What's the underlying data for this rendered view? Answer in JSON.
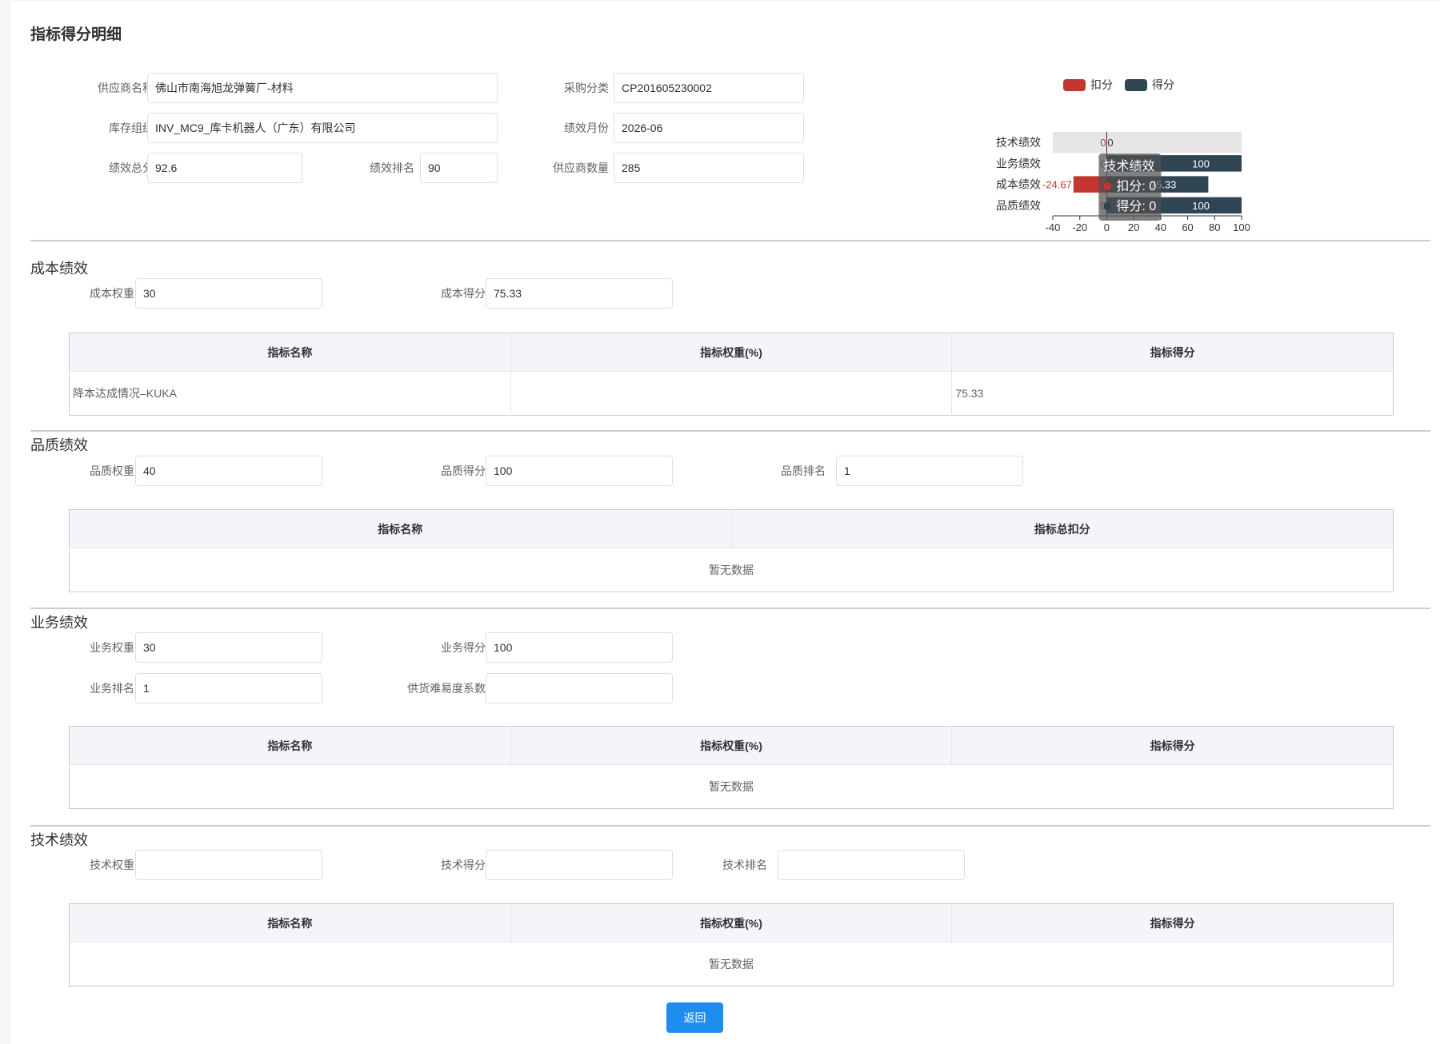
{
  "page": {
    "title": "指标得分明细"
  },
  "summary": {
    "supplier_name": {
      "label": "供应商名称",
      "value": "佛山市南海旭龙弹簧厂-材料"
    },
    "purchase_category": {
      "label": "采购分类",
      "value": "CP201605230002"
    },
    "inventory_org": {
      "label": "库存组织",
      "value": "INV_MC9_库卡机器人（广东）有限公司"
    },
    "perf_month": {
      "label": "绩效月份",
      "value": "2026-06"
    },
    "perf_total": {
      "label": "绩效总分",
      "value": "92.6"
    },
    "perf_rank": {
      "label": "绩效排名",
      "value": "90"
    },
    "supplier_count": {
      "label": "供应商数量",
      "value": "285"
    }
  },
  "chart_data": {
    "type": "bar",
    "orientation": "horizontal",
    "stacked": true,
    "categories": [
      "技术绩效",
      "业务绩效",
      "成本绩效",
      "品质绩效"
    ],
    "series": [
      {
        "name": "扣分",
        "color": "#c23531",
        "values": [
          0,
          0,
          -24.67,
          0
        ],
        "labels": [
          "0",
          "0",
          "-24.67",
          "0"
        ]
      },
      {
        "name": "得分",
        "color": "#2f4554",
        "values": [
          0,
          100,
          75.33,
          100
        ],
        "labels": [
          "0",
          "100",
          "75.33",
          "100"
        ]
      }
    ],
    "xlim": [
      -40,
      100
    ],
    "xticks": [
      "-40",
      "-20",
      "0",
      "20",
      "40",
      "60",
      "80",
      "100"
    ],
    "legend_position": "top",
    "highlight_category": "技术绩效",
    "tooltip": {
      "title": "技术绩效",
      "rows": [
        "扣分: 0",
        "得分: 0"
      ]
    }
  },
  "cost": {
    "title": "成本绩效",
    "weight": {
      "label": "成本权重",
      "value": "30"
    },
    "score": {
      "label": "成本得分",
      "value": "75.33"
    },
    "headers": [
      "指标名称",
      "指标权重(%)",
      "指标得分"
    ],
    "rows": [
      [
        "降本达成情况–KUKA",
        "",
        "75.33"
      ]
    ]
  },
  "quality": {
    "title": "品质绩效",
    "weight": {
      "label": "品质权重",
      "value": "40"
    },
    "score": {
      "label": "品质得分",
      "value": "100"
    },
    "rank": {
      "label": "品质排名",
      "value": "1"
    },
    "headers": [
      "指标名称",
      "指标总扣分"
    ],
    "empty_text": "暂无数据"
  },
  "business": {
    "title": "业务绩效",
    "weight": {
      "label": "业务权重",
      "value": "30"
    },
    "score": {
      "label": "业务得分",
      "value": "100"
    },
    "rank": {
      "label": "业务排名",
      "value": "1"
    },
    "difficulty": {
      "label": "供货难易度系数",
      "value": ""
    },
    "headers": [
      "指标名称",
      "指标权重(%)",
      "指标得分"
    ],
    "empty_text": "暂无数据"
  },
  "tech": {
    "title": "技术绩效",
    "weight": {
      "label": "技术权重",
      "value": ""
    },
    "score": {
      "label": "技术得分",
      "value": ""
    },
    "rank": {
      "label": "技术排名",
      "value": ""
    },
    "headers": [
      "指标名称",
      "指标权重(%)",
      "指标得分"
    ],
    "empty_text": "暂无数据"
  },
  "actions": {
    "back_label": "返回"
  }
}
